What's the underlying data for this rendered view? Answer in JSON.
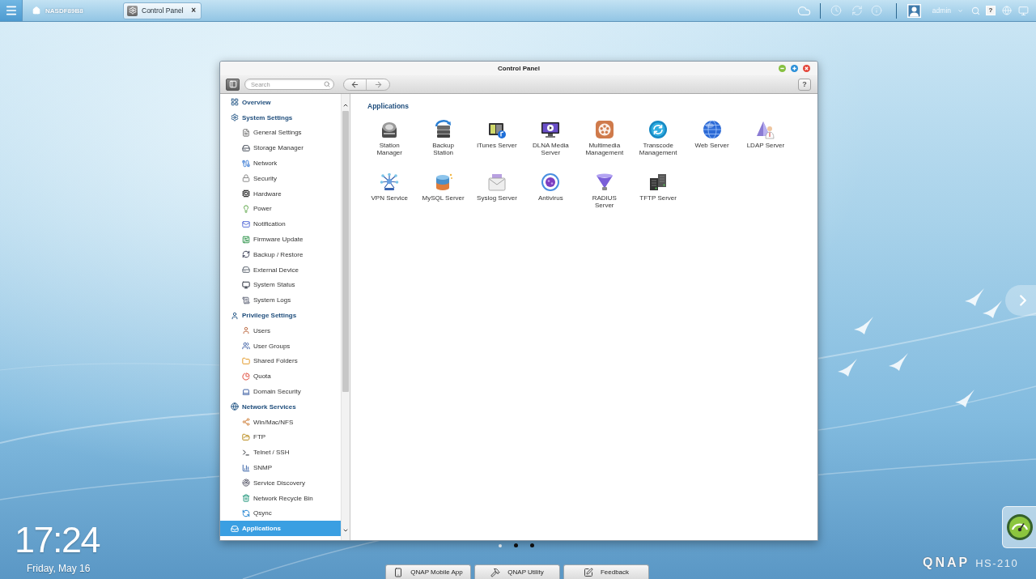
{
  "top_bar": {
    "home_label": "NASDF89B8",
    "windows": [
      {
        "label": "Control Panel",
        "selected": true,
        "close": "×"
      }
    ],
    "user": "admin",
    "help_label": "?"
  },
  "window": {
    "title": "Control Panel",
    "search": {
      "placeholder": "Search"
    },
    "help_label": "?"
  },
  "sidebar": {
    "items": [
      {
        "label": "Overview",
        "selected": false
      },
      {
        "label": "System Settings",
        "selected": false,
        "children": [
          {
            "label": "General Settings",
            "selected": false
          },
          {
            "label": "Storage Manager",
            "selected": false
          },
          {
            "label": "Network",
            "selected": false
          },
          {
            "label": "Security",
            "selected": false
          },
          {
            "label": "Hardware",
            "selected": false
          },
          {
            "label": "Power",
            "selected": false
          },
          {
            "label": "Notification",
            "selected": false
          },
          {
            "label": "Firmware Update",
            "selected": false
          },
          {
            "label": "Backup / Restore",
            "selected": false
          },
          {
            "label": "External Device",
            "selected": false
          },
          {
            "label": "System Status",
            "selected": false
          },
          {
            "label": "System Logs",
            "selected": false
          }
        ]
      },
      {
        "label": "Privilege Settings",
        "selected": false,
        "children": [
          {
            "label": "Users",
            "selected": false
          },
          {
            "label": "User Groups",
            "selected": false
          },
          {
            "label": "Shared Folders",
            "selected": false
          },
          {
            "label": "Quota",
            "selected": false
          },
          {
            "label": "Domain Security",
            "selected": false
          }
        ]
      },
      {
        "label": "Network Services",
        "selected": false,
        "children": [
          {
            "label": "Win/Mac/NFS",
            "selected": false
          },
          {
            "label": "FTP",
            "selected": false
          },
          {
            "label": "Telnet / SSH",
            "selected": false
          },
          {
            "label": "SNMP",
            "selected": false
          },
          {
            "label": "Service Discovery",
            "selected": false
          },
          {
            "label": "Network Recycle Bin",
            "selected": false
          },
          {
            "label": "Qsync",
            "selected": false
          }
        ]
      },
      {
        "label": "Applications",
        "selected": true
      }
    ]
  },
  "content": {
    "heading": "Applications",
    "apps": [
      {
        "label": "Station\nManager"
      },
      {
        "label": "Backup\nStation"
      },
      {
        "label": "iTunes Server"
      },
      {
        "label": "DLNA Media\nServer"
      },
      {
        "label": "Multimedia\nManagement"
      },
      {
        "label": "Transcode\nManagement"
      },
      {
        "label": "Web Server"
      },
      {
        "label": "LDAP Server"
      },
      {
        "label": "VPN Service"
      },
      {
        "label": "MySQL Server"
      },
      {
        "label": "Syslog Server"
      },
      {
        "label": "Antivirus"
      },
      {
        "label": "RADIUS\nServer"
      },
      {
        "label": "TFTP Server"
      }
    ]
  },
  "desktop": {
    "time": "17:24",
    "date": "Friday, May 16",
    "pages": [
      {
        "selected": true
      },
      {
        "selected": false
      },
      {
        "selected": false
      }
    ],
    "dock": [
      {
        "label": "QNAP Mobile App"
      },
      {
        "label": "QNAP Utility"
      },
      {
        "label": "Feedback"
      }
    ],
    "brand": "QNAP",
    "model": "HS-210"
  }
}
